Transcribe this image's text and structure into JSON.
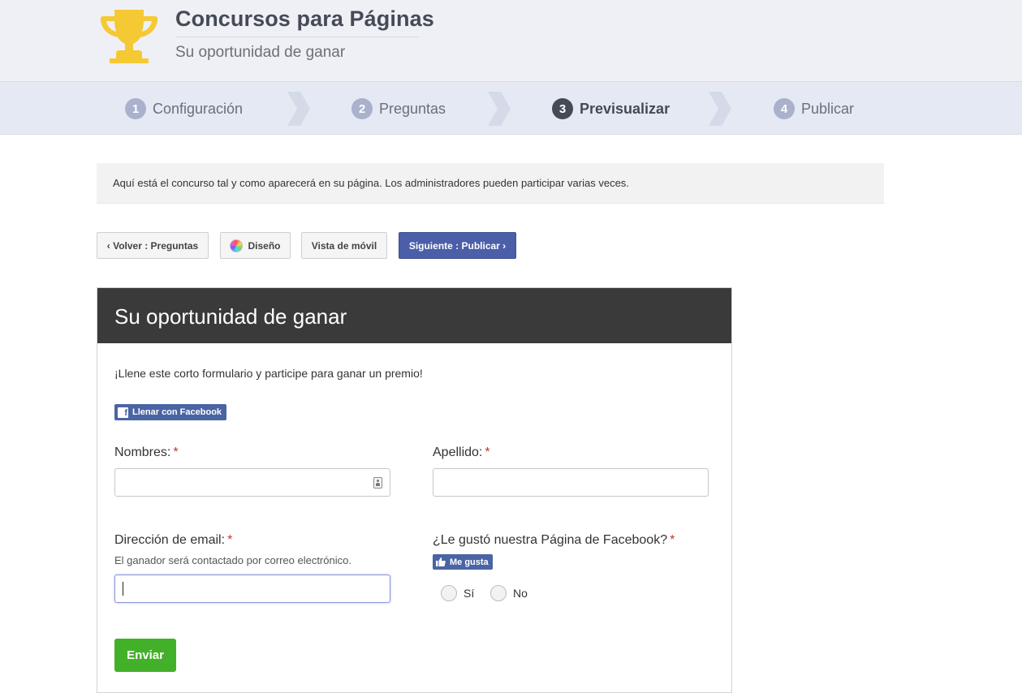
{
  "header": {
    "title": "Concursos para Páginas",
    "subtitle": "Su oportunidad de ganar",
    "trophy_color": "#f5c934"
  },
  "steps": [
    {
      "num": "1",
      "label": "Configuración"
    },
    {
      "num": "2",
      "label": "Preguntas"
    },
    {
      "num": "3",
      "label": "Previsualizar",
      "active": true
    },
    {
      "num": "4",
      "label": "Publicar"
    }
  ],
  "info": {
    "text": "Aquí está el concurso tal y como aparecerá en su página. Los administradores pueden participar varias veces."
  },
  "toolbar": {
    "back_label": "‹ Volver : Preguntas",
    "design_label": "Diseño",
    "mobile_label": "Vista de móvil",
    "next_label": "Siguiente : Publicar ›"
  },
  "contest": {
    "title": "Su oportunidad de ganar",
    "description": "¡Llene este corto formulario y participe para ganar un premio!",
    "fb_fill_label": "Llenar con Facebook",
    "fields": {
      "first_name": {
        "label": "Nombres:",
        "required": "*",
        "value": ""
      },
      "last_name": {
        "label": "Apellido:",
        "required": "*",
        "value": ""
      },
      "email": {
        "label": "Dirección de email:",
        "required": "*",
        "help": "El ganador será contactado por correo electrónico.",
        "value": ""
      },
      "liked": {
        "label": "¿Le gustó nuestra Página de Facebook?",
        "required": "*",
        "like_label": "Me gusta",
        "options": [
          "Sí",
          "No"
        ]
      }
    },
    "submit_label": "Enviar"
  },
  "colors": {
    "header_bg": "#eff0f5",
    "steps_bg": "#e5e9f3",
    "primary": "#4b5ea8",
    "facebook": "#4a64a4",
    "submit": "#43b02a",
    "card_header": "#3a3a3a",
    "required": "#c0392b"
  }
}
